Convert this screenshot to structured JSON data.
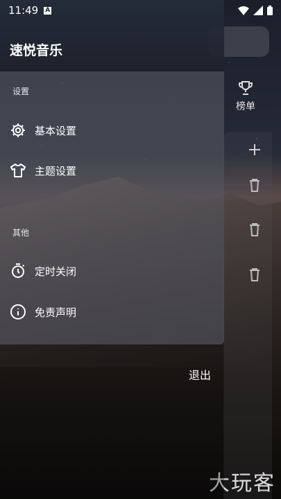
{
  "status_bar": {
    "time": "11:49",
    "notification_badge": "A",
    "icons": [
      "wifi-icon",
      "signal-icon",
      "battery-icon"
    ]
  },
  "drawer": {
    "app_title": "速悦音乐",
    "sections": [
      {
        "label": "设置",
        "items": [
          {
            "label": "基本设置",
            "icon": "gear-icon"
          },
          {
            "label": "主题设置",
            "icon": "shirt-icon"
          }
        ]
      },
      {
        "label": "其他",
        "items": [
          {
            "label": "定时关闭",
            "icon": "timer-icon"
          },
          {
            "label": "免责声明",
            "icon": "info-icon"
          }
        ]
      }
    ],
    "exit_label": "退出"
  },
  "background_page": {
    "charts_label": "榜单",
    "charts_icon": "trophy-icon",
    "actions": [
      "add-icon",
      "trash-icon",
      "trash-icon",
      "trash-icon"
    ]
  },
  "watermark": "大玩客"
}
